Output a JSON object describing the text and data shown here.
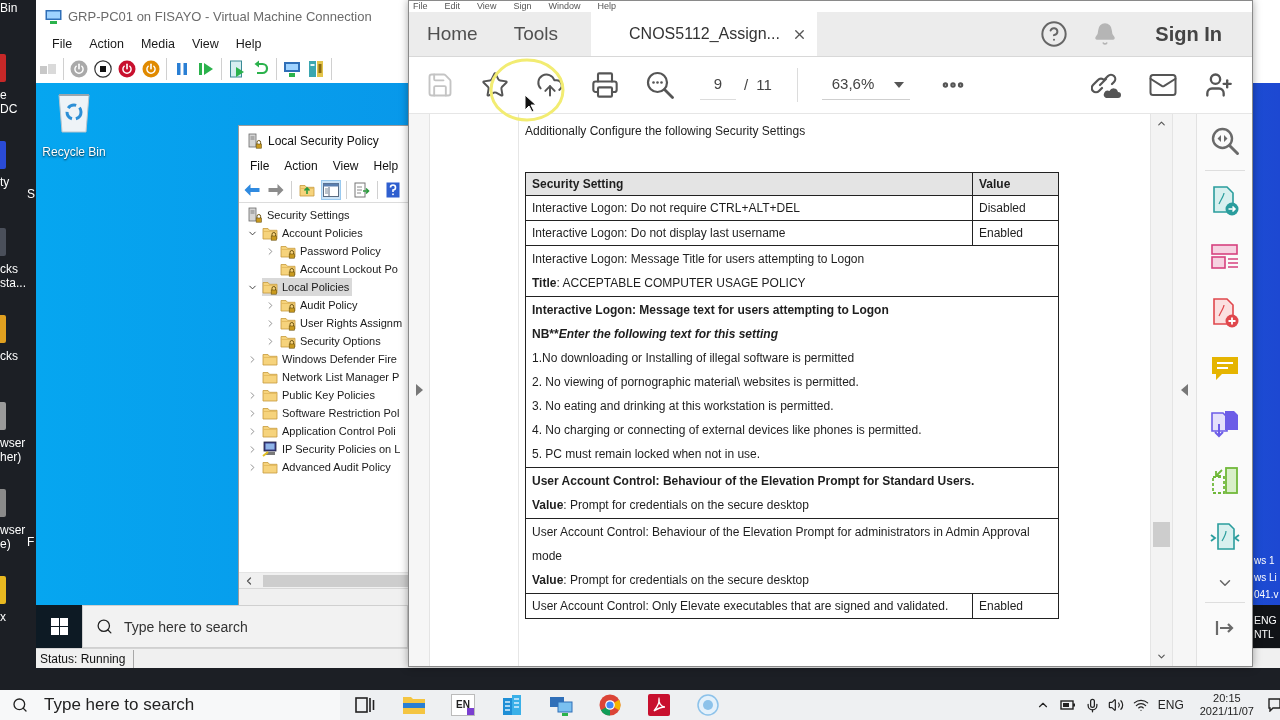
{
  "host_desktop": {
    "icons": [
      {
        "lines": [
          "Bin"
        ]
      },
      {
        "lines": [
          "e",
          "DC"
        ]
      },
      {
        "lines": [
          "ty"
        ],
        "peek": "S"
      },
      {
        "lines": [
          "cks",
          "sta..."
        ]
      },
      {
        "lines": [
          "cks"
        ]
      },
      {
        "lines": [
          "wser",
          "her)"
        ]
      },
      {
        "lines": [
          "wser",
          "e)"
        ],
        "peek": "F"
      },
      {
        "lines": [
          "x"
        ]
      }
    ]
  },
  "vm_window": {
    "title": "GRP-PC01 on FISAYO - Virtual Machine Connection",
    "menu": [
      "File",
      "Action",
      "Media",
      "View",
      "Help"
    ],
    "desktop_icons": [
      {
        "label": "Recycle Bin"
      }
    ],
    "local_security_policy": {
      "title": "Local Security Policy",
      "menu": [
        "File",
        "Action",
        "View",
        "Help"
      ],
      "toolbar": [
        {
          "kind": "back",
          "selected": false
        },
        {
          "kind": "forward",
          "selected": false
        },
        {
          "kind": "up",
          "selected": false
        },
        {
          "kind": "console-tree",
          "selected": true
        },
        {
          "kind": "export",
          "selected": false
        },
        {
          "kind": "help",
          "selected": false
        }
      ],
      "tree": [
        {
          "label": "Security Settings",
          "kind": "root",
          "selected": false,
          "children": [
            {
              "label": "Account Policies",
              "kind": "locked-folder",
              "expanded": true,
              "selected": false,
              "children": [
                {
                  "label": "Password Policy",
                  "kind": "locked-folder",
                  "expanded": false,
                  "selected": false
                },
                {
                  "label": "Account Lockout Po",
                  "kind": "locked-folder",
                  "selected": false
                }
              ]
            },
            {
              "label": "Local Policies",
              "kind": "locked-folder",
              "expanded": true,
              "selected": true,
              "children": [
                {
                  "label": "Audit Policy",
                  "kind": "locked-folder",
                  "expanded": false,
                  "selected": false
                },
                {
                  "label": "User Rights Assignm",
                  "kind": "locked-folder",
                  "expanded": false,
                  "selected": false
                },
                {
                  "label": "Security Options",
                  "kind": "locked-folder",
                  "expanded": false,
                  "selected": false
                }
              ]
            },
            {
              "label": "Windows Defender Fire",
              "kind": "folder",
              "expanded": false,
              "selected": false
            },
            {
              "label": "Network List Manager P",
              "kind": "folder",
              "selected": false
            },
            {
              "label": "Public Key Policies",
              "kind": "folder",
              "expanded": false,
              "selected": false
            },
            {
              "label": "Software Restriction Pol",
              "kind": "folder",
              "expanded": false,
              "selected": false
            },
            {
              "label": "Application Control Poli",
              "kind": "folder",
              "expanded": false,
              "selected": false
            },
            {
              "label": "IP Security Policies on L",
              "kind": "computer",
              "expanded": false,
              "selected": false
            },
            {
              "label": "Advanced Audit Policy",
              "kind": "folder",
              "expanded": false,
              "selected": false
            }
          ]
        }
      ]
    },
    "taskbar": {
      "search": {
        "placeholder": "Type here to search"
      },
      "tray": [
        "ENG",
        "NTL"
      ]
    },
    "activation_notice_fragments": [
      "ws 1",
      "ws Li",
      "041.v"
    ],
    "status": "Status: Running"
  },
  "acrobat": {
    "menu": [
      "File",
      "Edit",
      "View",
      "Sign",
      "Window",
      "Help"
    ],
    "tabs": [
      {
        "label": "Home",
        "kind": "nav",
        "selected": false
      },
      {
        "label": "Tools",
        "kind": "nav",
        "selected": false
      },
      {
        "label": "CNOS5112_Assign...",
        "kind": "document",
        "selected": true
      }
    ],
    "sign_in": "Sign In",
    "toolbar": {
      "save": {
        "disabled": true
      },
      "page_current": "9",
      "page_separator": "/",
      "page_total": "11",
      "zoom": "63,6%"
    },
    "document": {
      "intro": "Additionally Configure the following Security Settings",
      "table": {
        "columns": [
          "Security Setting",
          "Value"
        ],
        "rows": [
          {
            "kind": "pair",
            "setting": "Interactive Logon: Do not require CTRL+ALT+DEL",
            "value": "Disabled"
          },
          {
            "kind": "pair",
            "setting": "Interactive Logon: Do not display last username",
            "value": "Enabled"
          },
          {
            "kind": "merged",
            "lines": [
              {
                "kind": "plain",
                "text": "Interactive Logon: Message Title for users attempting to Logon"
              },
              {
                "kind": "plain",
                "text": "**Title**: ACCEPTABLE COMPUTER USAGE POLICY"
              }
            ]
          },
          {
            "kind": "merged",
            "lines": [
              {
                "kind": "bold",
                "text": "Interactive Logon: Message text for users attempting to Logon"
              },
              {
                "kind": "note",
                "prefix": "NB**",
                "text": "Enter the following text for this setting"
              },
              {
                "kind": "plain",
                "text": "1.No downloading or Installing of illegal software is permitted"
              },
              {
                "kind": "plain",
                "text": "2. No viewing of pornographic material\\ websites is permitted."
              },
              {
                "kind": "plain",
                "text": "3. No eating and drinking at this workstation is permitted."
              },
              {
                "kind": "plain",
                "text": "4. No charging or connecting of external devices like phones is permitted."
              },
              {
                "kind": "plain",
                "text": "5. PC must remain locked when not in use."
              }
            ]
          },
          {
            "kind": "merged",
            "lines": [
              {
                "kind": "bold",
                "text": "User Account Control: Behaviour of the Elevation Prompt for Standard Users."
              },
              {
                "kind": "plain",
                "text": "**Value**: Prompt for credentials on the secure desktop"
              }
            ]
          },
          {
            "kind": "merged",
            "lines": [
              {
                "kind": "plain",
                "text": "User Account Control: Behaviour of the Elevation Prompt for administrators in Admin Approval mode"
              },
              {
                "kind": "plain",
                "text": "**Value**: Prompt for credentials on the secure desktop"
              }
            ]
          },
          {
            "kind": "pair",
            "setting": "User Account Control: Only Elevate executables that are signed and validated.",
            "value": "Enabled"
          }
        ]
      }
    }
  },
  "host_taskbar": {
    "search": {
      "placeholder": "Type here to search"
    },
    "apps": [
      {
        "kind": "task-view"
      },
      {
        "kind": "file-explorer"
      },
      {
        "kind": "text-tile",
        "label": "EN"
      },
      {
        "kind": "building"
      },
      {
        "kind": "network"
      },
      {
        "kind": "browser"
      },
      {
        "kind": "pdf"
      },
      {
        "kind": "recorder"
      }
    ],
    "language": "ENG",
    "time": "20:15",
    "date": "2021/11/07"
  }
}
